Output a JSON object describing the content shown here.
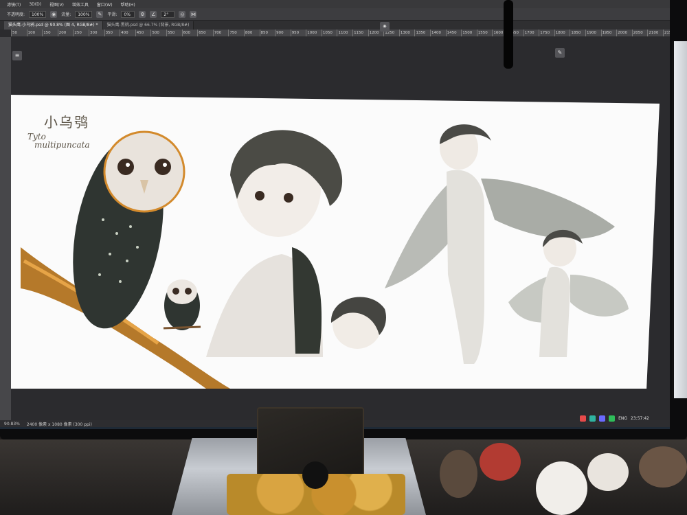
{
  "photoshop": {
    "menu": [
      "滤镜(T)",
      "3D(D)",
      "视图(V)",
      "增效工具",
      "窗口(W)",
      "帮助(H)"
    ],
    "options": {
      "mode_label": "不透明度:",
      "opacity_value": "100%",
      "flow_label": "流量:",
      "flow_value": "100%",
      "smoothing_label": "平滑:",
      "smoothing_value": "0%",
      "angle_value": "2°"
    },
    "tabs": [
      {
        "label": "猫头鹰-小乌鸦.psd @ 90.8% (图 4, RGB/8#) *",
        "active": true
      },
      {
        "label": "猫头鹰-黑桃.psd @ 66.7% (背景, RGB/8#)",
        "active": false
      }
    ],
    "ruler_ticks": [
      "50",
      "100",
      "150",
      "200",
      "250",
      "300",
      "350",
      "400",
      "450",
      "500",
      "550",
      "600",
      "650",
      "700",
      "750",
      "800",
      "850",
      "900",
      "950",
      "1000",
      "1050",
      "1100",
      "1150",
      "1200",
      "1250",
      "1300",
      "1350",
      "1400",
      "1450",
      "1500",
      "1550",
      "1600",
      "1650",
      "1700",
      "1750",
      "1800",
      "1850",
      "1900",
      "1950",
      "2000",
      "2050",
      "2100",
      "2150",
      "2200",
      "2250",
      "2300",
      "2350",
      "2400"
    ],
    "status": {
      "zoom": "90.83%",
      "doc_size": "2400 像素 x 1080 像素 (300 ppi)"
    },
    "tray": {
      "lang": "ENG",
      "time": "23:57:42"
    }
  },
  "artwork": {
    "title_cn": "小乌鸮",
    "title_latin_1": "Tyto",
    "title_latin_2": "multipuncata"
  },
  "colors": {
    "ps_dark": "#2b2b2e",
    "canvas": "#fbfbfb",
    "owl_dark": "#2f3531",
    "branch": "#b5792a"
  }
}
